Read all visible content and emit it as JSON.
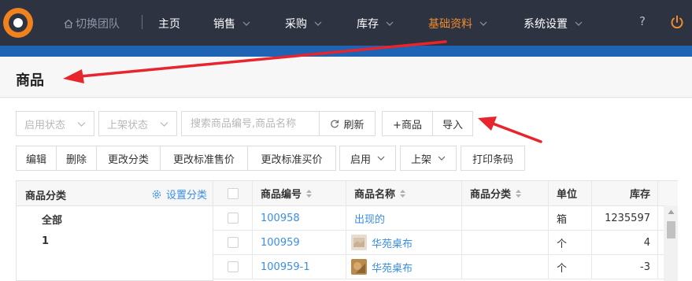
{
  "nav": {
    "switch_team": "切换团队",
    "items": [
      {
        "label": "主页",
        "has_menu": false
      },
      {
        "label": "销售",
        "has_menu": true
      },
      {
        "label": "采购",
        "has_menu": true
      },
      {
        "label": "库存",
        "has_menu": true
      },
      {
        "label": "基础资料",
        "has_menu": true,
        "active": true
      },
      {
        "label": "系统设置",
        "has_menu": true
      }
    ],
    "help": "?"
  },
  "page": {
    "title": "商品"
  },
  "toolbar": {
    "enable_status": "启用状态",
    "shelf_status": "上架状态",
    "search_placeholder": "搜索商品编号,商品名称",
    "refresh": "刷新",
    "add_product": "+商品",
    "import": "导入"
  },
  "actions": {
    "edit": "编辑",
    "delete": "删除",
    "change_category": "更改分类",
    "change_std_sell_price": "更改标准售价",
    "change_std_buy_price": "更改标准买价",
    "enable": "启用",
    "shelve": "上架",
    "print_barcode": "打印条码"
  },
  "categories": {
    "header": "商品分类",
    "settings": "设置分类",
    "items": [
      "全部",
      "1"
    ]
  },
  "table": {
    "columns": [
      "商品编号",
      "商品名称",
      "商品分类",
      "单位",
      "库存"
    ],
    "rows": [
      {
        "code": "100958",
        "name": "出现的",
        "category": "",
        "unit": "箱",
        "stock": "1235597"
      },
      {
        "code": "100959",
        "name": "华苑桌布",
        "category": "",
        "unit": "个",
        "stock": "4"
      },
      {
        "code": "100959-1",
        "name": "华苑桌布",
        "category": "",
        "unit": "个",
        "stock": "-3"
      }
    ]
  },
  "colors": {
    "nav_bg": "#2e3342",
    "accent": "#f08c2c",
    "brand_blue": "#1e63b4",
    "link": "#3a8ee6",
    "annotation_arrow": "#e8242c"
  }
}
